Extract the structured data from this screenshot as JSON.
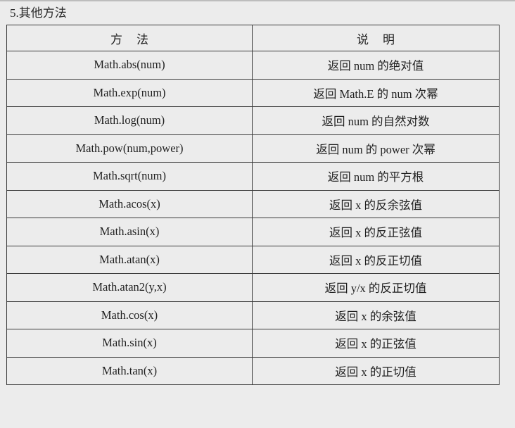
{
  "section": {
    "title": "5.其他方法"
  },
  "table": {
    "headers": [
      "方法",
      "说明"
    ],
    "rows": [
      {
        "method": "Math.abs(num)",
        "desc": "返回 num 的绝对值"
      },
      {
        "method": "Math.exp(num)",
        "desc": "返回 Math.E 的 num 次幂"
      },
      {
        "method": "Math.log(num)",
        "desc": "返回 num 的自然对数"
      },
      {
        "method": "Math.pow(num,power)",
        "desc": "返回 num 的 power 次幂"
      },
      {
        "method": "Math.sqrt(num)",
        "desc": "返回 num 的平方根"
      },
      {
        "method": "Math.acos(x)",
        "desc": "返回 x 的反余弦值"
      },
      {
        "method": "Math.asin(x)",
        "desc": "返回 x 的反正弦值"
      },
      {
        "method": "Math.atan(x)",
        "desc": "返回 x 的反正切值"
      },
      {
        "method": "Math.atan2(y,x)",
        "desc": "返回 y/x 的反正切值"
      },
      {
        "method": "Math.cos(x)",
        "desc": "返回 x 的余弦值"
      },
      {
        "method": "Math.sin(x)",
        "desc": "返回 x 的正弦值"
      },
      {
        "method": "Math.tan(x)",
        "desc": "返回 x 的正切值"
      }
    ]
  }
}
